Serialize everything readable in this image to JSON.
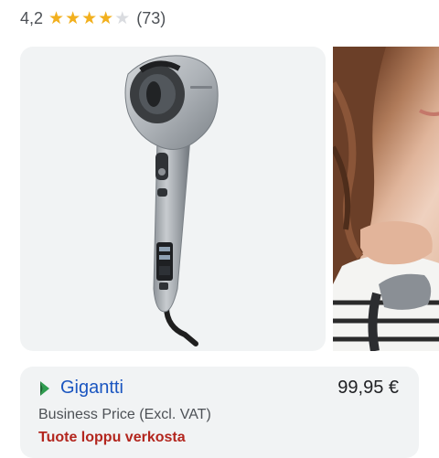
{
  "rating": {
    "value": "4,2",
    "stars_filled": 4,
    "stars_total": 5,
    "count": "(73)",
    "star_color": "#f2b01e"
  },
  "gallery": {
    "images": [
      {
        "subject": "hair-curler-product-image"
      },
      {
        "subject": "woman-using-hair-curler-image"
      }
    ]
  },
  "offer": {
    "seller": "Gigantti",
    "price": "99,95 €",
    "note": "Business Price (Excl. VAT)",
    "stock": "Tuote loppu verkosta",
    "seller_color": "#1a55c0",
    "stock_color": "#b3261e"
  }
}
